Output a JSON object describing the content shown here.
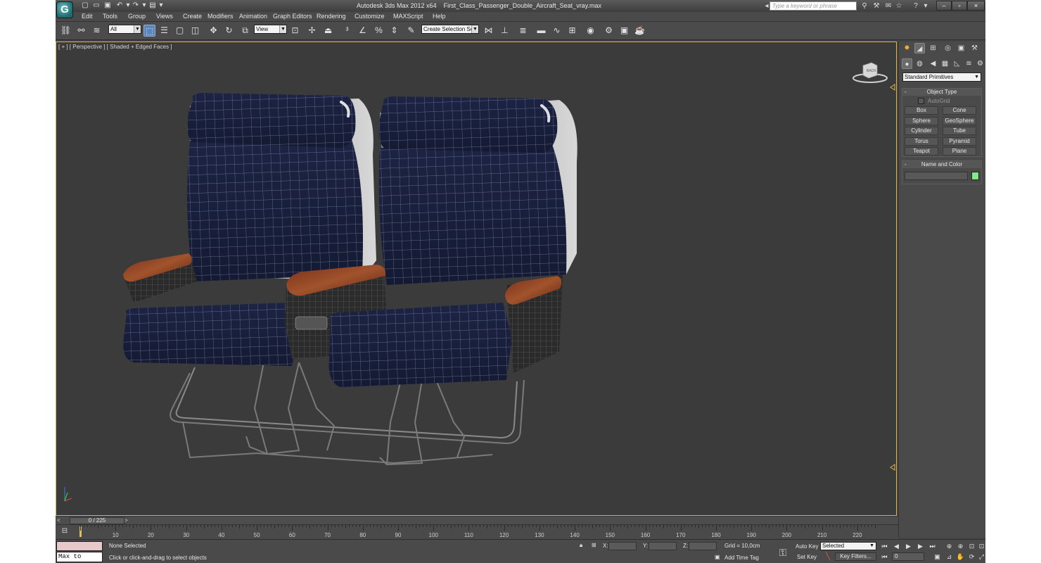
{
  "app": {
    "title": "Autodesk 3ds Max  2012 x64",
    "filename": "First_Class_Passenger_Double_Aircraft_Seat_vray.max",
    "logo_glyph": "G",
    "search_placeholder": "Type a keyword or phrase"
  },
  "menu": [
    "Edit",
    "Tools",
    "Group",
    "Views",
    "Create",
    "Modifiers",
    "Animation",
    "Graph Editors",
    "Rendering",
    "Customize",
    "MAXScript",
    "Help"
  ],
  "toolbar": {
    "selection_filter": "All",
    "reference_coord": "View",
    "named_selection_placeholder": "Create Selection Se"
  },
  "viewport": {
    "label": "[ + ] [ Perspective ] [ Shaded + Edged Faces ]",
    "viewcube_face": "BACK",
    "frame_color": "#e2b63c"
  },
  "command_panel": {
    "category": "Standard Primitives",
    "object_type": {
      "title": "Object Type",
      "autogrid_label": "AutoGrid",
      "buttons": [
        "Box",
        "Cone",
        "Sphere",
        "GeoSphere",
        "Cylinder",
        "Tube",
        "Torus",
        "Pyramid",
        "Teapot",
        "Plane"
      ]
    },
    "name_and_color": {
      "title": "Name and Color",
      "color": "#86e68a"
    }
  },
  "timeline": {
    "frame_display": "0 / 225",
    "ticks": [
      "10",
      "20",
      "30",
      "40",
      "50",
      "60",
      "70",
      "80",
      "90",
      "100",
      "110",
      "120",
      "130",
      "140",
      "150",
      "160",
      "170",
      "180",
      "190",
      "200",
      "210",
      "220"
    ]
  },
  "status": {
    "maxscript_listener": "Max to Physc",
    "selection_status": "None Selected",
    "prompt": "Click or click-and-drag to select objects",
    "x_label": "X:",
    "y_label": "Y:",
    "z_label": "Z:",
    "grid": "Grid = 10,0cm",
    "add_time_tag": "Add Time Tag",
    "auto_key": "Auto Key",
    "set_key": "Set Key",
    "key_mode": "Selected",
    "key_filters": "Key Filters...",
    "current_frame": "0"
  }
}
